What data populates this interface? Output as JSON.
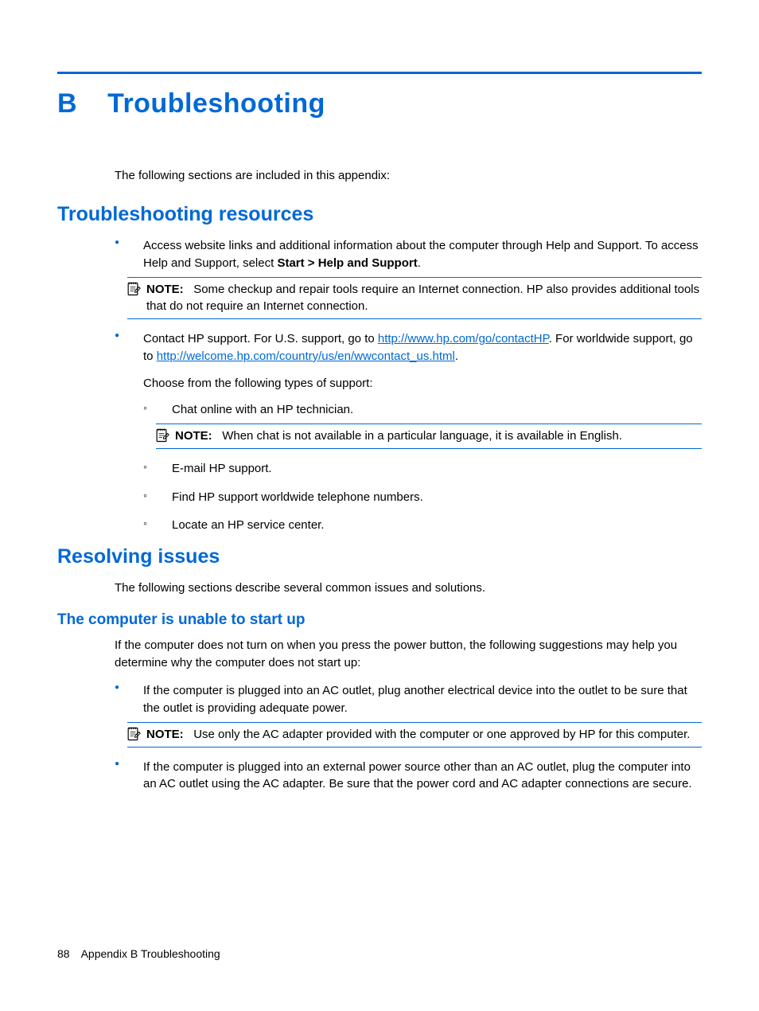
{
  "title": {
    "letter": "B",
    "text": "Troubleshooting"
  },
  "intro": "The following sections are included in this appendix:",
  "sec1": {
    "heading": "Troubleshooting resources",
    "b1_pre": "Access website links and additional information about the computer through Help and Support. To access Help and Support, select ",
    "b1_bold": "Start > Help and Support",
    "b1_post": ".",
    "note1_label": "NOTE:",
    "note1_text": "Some checkup and repair tools require an Internet connection. HP also provides additional tools that do not require an Internet connection.",
    "b2_pre": "Contact HP support. For U.S. support, go to ",
    "b2_link1": "http://www.hp.com/go/contactHP",
    "b2_mid": ". For worldwide support, go to ",
    "b2_link2": "http://welcome.hp.com/country/us/en/wwcontact_us.html",
    "b2_post": ".",
    "b2_sub_intro": "Choose from the following types of support:",
    "sub1": "Chat online with an HP technician.",
    "note2_label": "NOTE:",
    "note2_text": "When chat is not available in a particular language, it is available in English.",
    "sub2": "E-mail HP support.",
    "sub3": "Find HP support worldwide telephone numbers.",
    "sub4": "Locate an HP service center."
  },
  "sec2": {
    "heading": "Resolving issues",
    "intro": "The following sections describe several common issues and solutions.",
    "sub_heading": "The computer is unable to start up",
    "p1": "If the computer does not turn on when you press the power button, the following suggestions may help you determine why the computer does not start up:",
    "b1": "If the computer is plugged into an AC outlet, plug another electrical device into the outlet to be sure that the outlet is providing adequate power.",
    "note_label": "NOTE:",
    "note_text": "Use only the AC adapter provided with the computer or one approved by HP for this computer.",
    "b2": "If the computer is plugged into an external power source other than an AC outlet, plug the computer into an AC outlet using the AC adapter. Be sure that the power cord and AC adapter connections are secure."
  },
  "footer": {
    "page": "88",
    "text": "Appendix B   Troubleshooting"
  }
}
